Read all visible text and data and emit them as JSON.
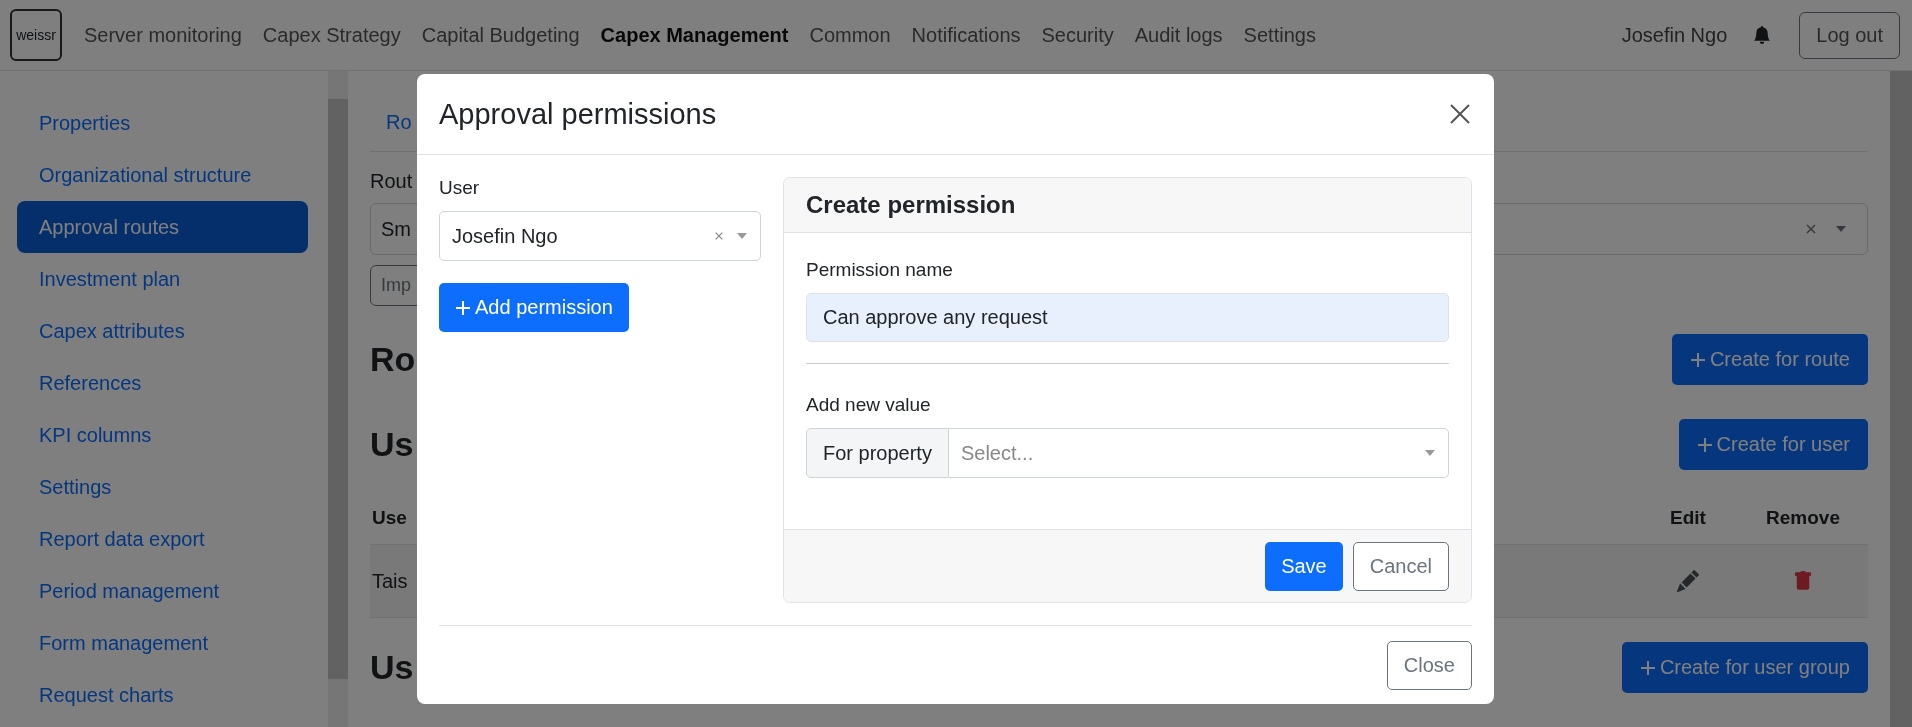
{
  "navbar": {
    "logo": "weissr",
    "menu": [
      {
        "label": "Server monitoring",
        "selected": false
      },
      {
        "label": "Capex Strategy",
        "selected": false
      },
      {
        "label": "Capital Budgeting",
        "selected": false
      },
      {
        "label": "Capex Management",
        "selected": true
      },
      {
        "label": "Common",
        "selected": false
      },
      {
        "label": "Notifications",
        "selected": false
      },
      {
        "label": "Security",
        "selected": false
      },
      {
        "label": "Audit logs",
        "selected": false
      },
      {
        "label": "Settings",
        "selected": false
      }
    ],
    "user": "Josefin Ngo",
    "logout": "Log out"
  },
  "sidebar": {
    "items": [
      {
        "label": "Properties",
        "selected": false
      },
      {
        "label": "Organizational structure",
        "selected": false
      },
      {
        "label": "Approval routes",
        "selected": true
      },
      {
        "label": "Investment plan",
        "selected": false
      },
      {
        "label": "Capex attributes",
        "selected": false
      },
      {
        "label": "References",
        "selected": false
      },
      {
        "label": "KPI columns",
        "selected": false
      },
      {
        "label": "Settings",
        "selected": false
      },
      {
        "label": "Report data export",
        "selected": false
      },
      {
        "label": "Period management",
        "selected": false
      },
      {
        "label": "Form management",
        "selected": false
      },
      {
        "label": "Request charts",
        "selected": false
      }
    ]
  },
  "page": {
    "tab": "Ro",
    "route_label": "Rout",
    "route_select": "Sm",
    "import_button": "Imp",
    "route_section": {
      "heading": "Ro",
      "button": "Create for route"
    },
    "user_section": {
      "heading": "Us",
      "button": "Create for user"
    },
    "table": {
      "columns": [
        "Use",
        "Edit",
        "Remove"
      ],
      "rows": [
        {
          "user": "Tais"
        }
      ]
    },
    "group_section": {
      "heading": "Us",
      "button": "Create for user group"
    }
  },
  "modal": {
    "title": "Approval permissions",
    "user_label": "User",
    "user_select": "Josefin Ngo",
    "add_button": "Add permission",
    "card": {
      "title": "Create permission",
      "name_label": "Permission name",
      "name_value": "Can approve any request",
      "new_value_label": "Add new value",
      "property_addon": "For property",
      "property_placeholder": "Select...",
      "save": "Save",
      "cancel": "Cancel"
    },
    "close_button": "Close"
  }
}
